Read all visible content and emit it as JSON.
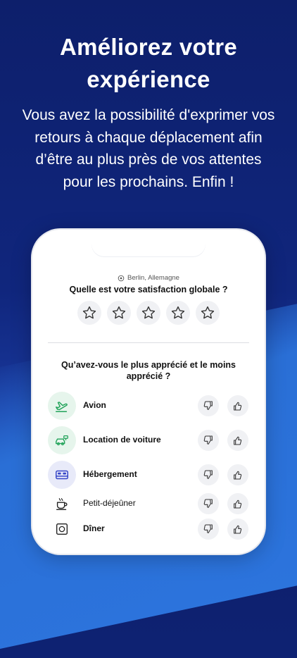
{
  "hero": {
    "title_line1": "Améliorez votre",
    "title_line2": "expérience",
    "description": "Vous avez la possibilité d'exprimer vos retours à chaque déplacement afin d’être au plus près de vos attentes pour les prochains. Enfin !"
  },
  "screen": {
    "location": "Berlin, Allemagne",
    "global_question": "Quelle est votre satisfaction globale ?",
    "stars_count": 5,
    "rating_value": 0,
    "category_question": "Qu’avez-vous le plus apprécié et le moins apprécié ?",
    "categories": [
      {
        "label": "Avion",
        "icon": "plane-icon",
        "color": "#22a35a",
        "bg": "#e6f5ec"
      },
      {
        "label": "Location de voiture",
        "icon": "car-rental-icon",
        "color": "#22a35a",
        "bg": "#e6f5ec"
      },
      {
        "label": "Hébergement",
        "icon": "bed-icon",
        "color": "#3545c8",
        "bg": "#e8eaf9"
      },
      {
        "label": "Petit-déjeûner",
        "icon": "coffee-icon",
        "color": "#222222",
        "bg": "#ffffff"
      },
      {
        "label": "Dîner",
        "icon": "dinner-icon",
        "color": "#222222",
        "bg": "#ffffff"
      }
    ]
  },
  "colors": {
    "background_top": "#0d1f6b",
    "background_bottom": "#2363c9",
    "accent_green": "#22a35a",
    "accent_blue": "#3545c8"
  }
}
